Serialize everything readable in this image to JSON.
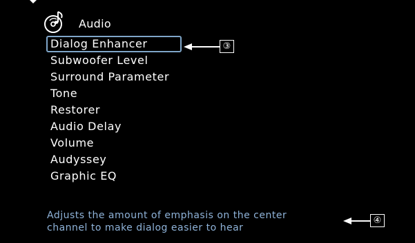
{
  "screen": {
    "title": "Audio",
    "icon": "audio-disc-note-icon"
  },
  "menu": {
    "items": [
      {
        "label": "Dialog Enhancer",
        "selected": true
      },
      {
        "label": "Subwoofer Level",
        "selected": false
      },
      {
        "label": "Surround Parameter",
        "selected": false
      },
      {
        "label": "Tone",
        "selected": false
      },
      {
        "label": "Restorer",
        "selected": false
      },
      {
        "label": "Audio Delay",
        "selected": false
      },
      {
        "label": "Volume",
        "selected": false
      },
      {
        "label": "Audyssey",
        "selected": false
      },
      {
        "label": "Graphic EQ",
        "selected": false
      }
    ]
  },
  "description": {
    "line1": "Adjusts the amount of emphasis on the center",
    "line2": "channel to make dialog easier to hear"
  },
  "callouts": {
    "menu_callout": "③",
    "description_callout": "④"
  },
  "colors": {
    "background": "#000000",
    "text": "#ffffff",
    "selection_border": "#7fa6c9",
    "description_text": "#8fb3d9"
  }
}
